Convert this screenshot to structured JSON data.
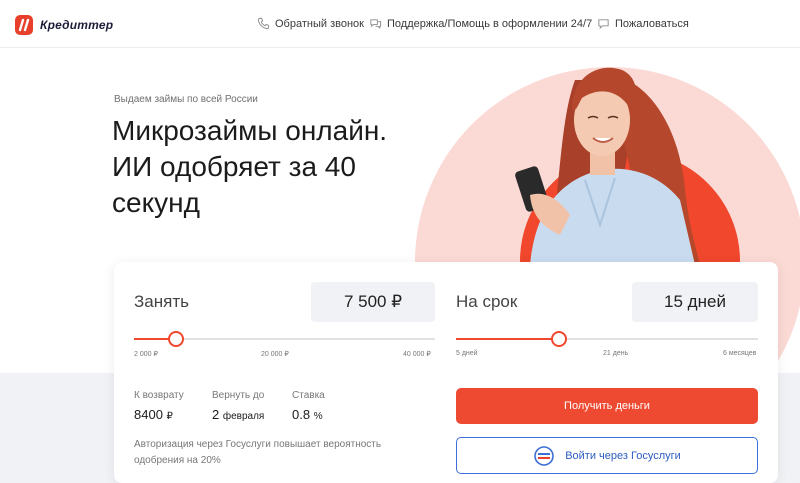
{
  "header": {
    "brand": "Кредиттер",
    "nav": [
      {
        "label": "Обратный звонок",
        "icon": "phone-icon"
      },
      {
        "label": "Поддержка/Помощь в оформлении 24/7",
        "icon": "chat-icon"
      },
      {
        "label": "Пожаловаться",
        "icon": "comment-icon"
      }
    ]
  },
  "hero": {
    "subtitle": "Выдаем займы по всей России",
    "title": "Микрозаймы онлайн. ИИ одобряет за 40 секунд"
  },
  "calculator": {
    "amount": {
      "label": "Занять",
      "value": "7 500 ₽",
      "ticks": [
        "2 000 ₽",
        "20 000 ₽",
        "40 000 ₽"
      ],
      "level": 0.14
    },
    "term": {
      "label": "На срок",
      "value": "15 дней",
      "ticks": [
        "5 дней",
        "21 день",
        "6 месяцев"
      ],
      "level": 0.34
    },
    "stats": [
      {
        "label": "К возврату",
        "value": "8400",
        "unit": "₽"
      },
      {
        "label": "Вернуть до",
        "value": "2",
        "unit": "февраля"
      },
      {
        "label": "Ставка",
        "value": "0.8",
        "unit": "%"
      }
    ],
    "note": "Авторизация через Госуслуги повышает вероятность одобрения на 20%",
    "primary_button": "Получить деньги",
    "secondary_button": "Войти через Госуслуги"
  },
  "colors": {
    "accent": "#f0472d",
    "accent_light": "#fbd9d4",
    "gosuslugi_blue": "#3d6fd8"
  }
}
